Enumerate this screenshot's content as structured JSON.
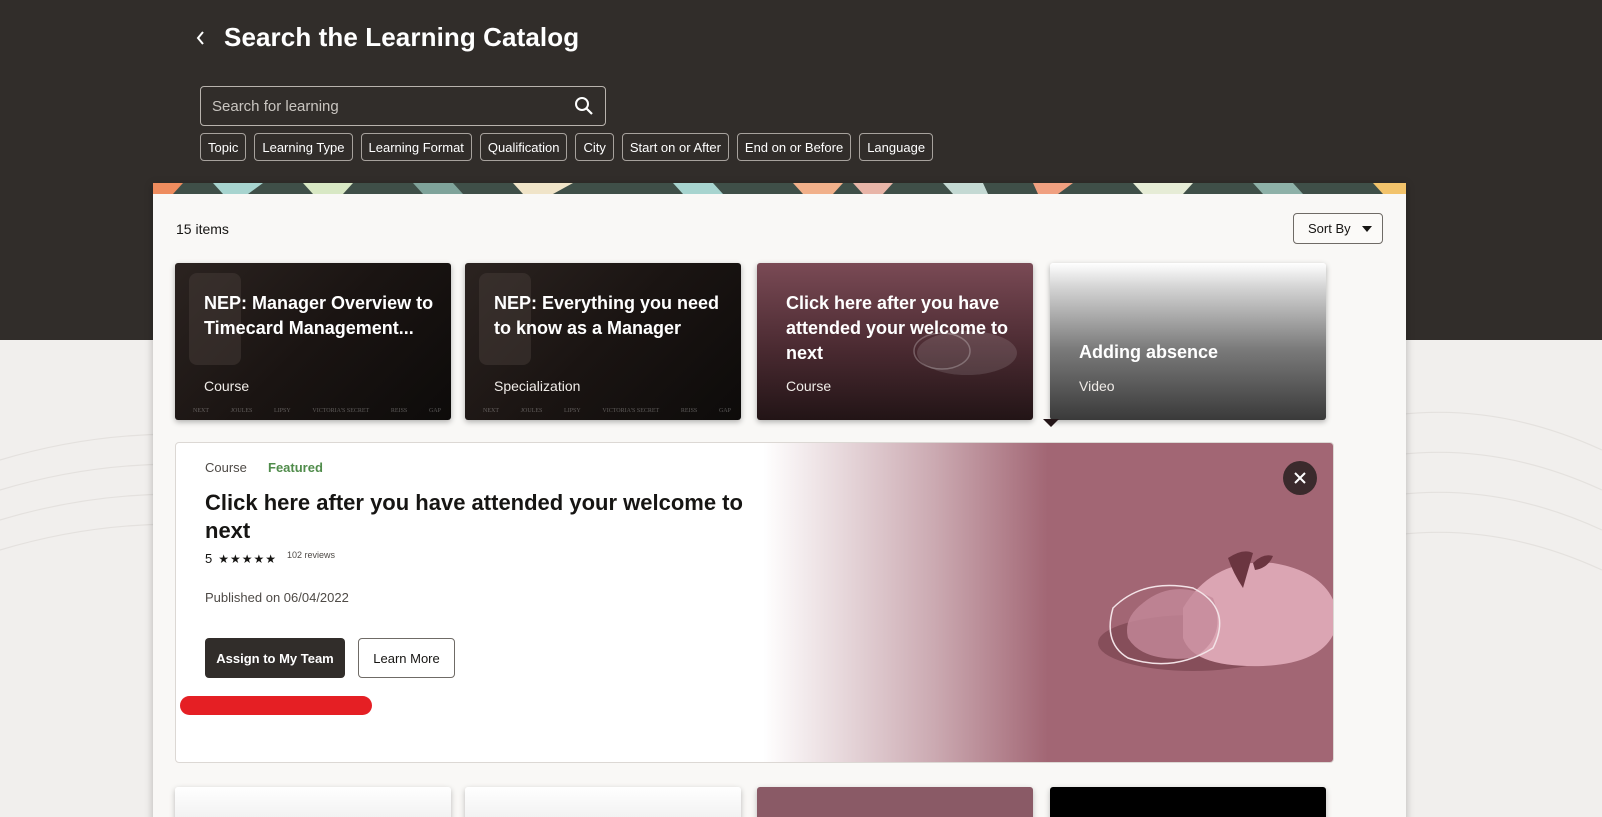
{
  "header": {
    "title": "Search the Learning Catalog",
    "back_icon": "chevron-left-icon"
  },
  "search": {
    "placeholder": "Search for learning",
    "icon": "search-icon"
  },
  "filters": [
    "Topic",
    "Learning Type",
    "Learning Format",
    "Qualification",
    "City",
    "Start on or After",
    "End on or Before",
    "Language"
  ],
  "results": {
    "count_label": "15 items",
    "sort_label": "Sort By"
  },
  "cards": [
    {
      "title": "NEP: Manager Overview to Timecard Management...",
      "type": "Course"
    },
    {
      "title": "NEP: Everything you need to know as a Manager",
      "type": "Specialization"
    },
    {
      "title": "Click here after you have attended your welcome to next",
      "type": "Course"
    },
    {
      "title": "Adding absence",
      "type": "Video"
    }
  ],
  "card_brands": [
    "NEXT",
    "JOULES",
    "LIPSY",
    "VICTORIA'S SECRET",
    "REISS",
    "GAP"
  ],
  "detail": {
    "type": "Course",
    "badge": "Featured",
    "title": "Click here after you have attended your welcome to next",
    "rating": "5",
    "stars": "★★★★★",
    "reviews": "102 reviews",
    "published": "Published on 06/04/2022",
    "assign_label": "Assign to My Team",
    "learn_label": "Learn More"
  },
  "colors": {
    "header_bg": "#312d2a",
    "featured": "#508c4b",
    "detail_art": "#a26674",
    "redaction": "#e51f24"
  }
}
